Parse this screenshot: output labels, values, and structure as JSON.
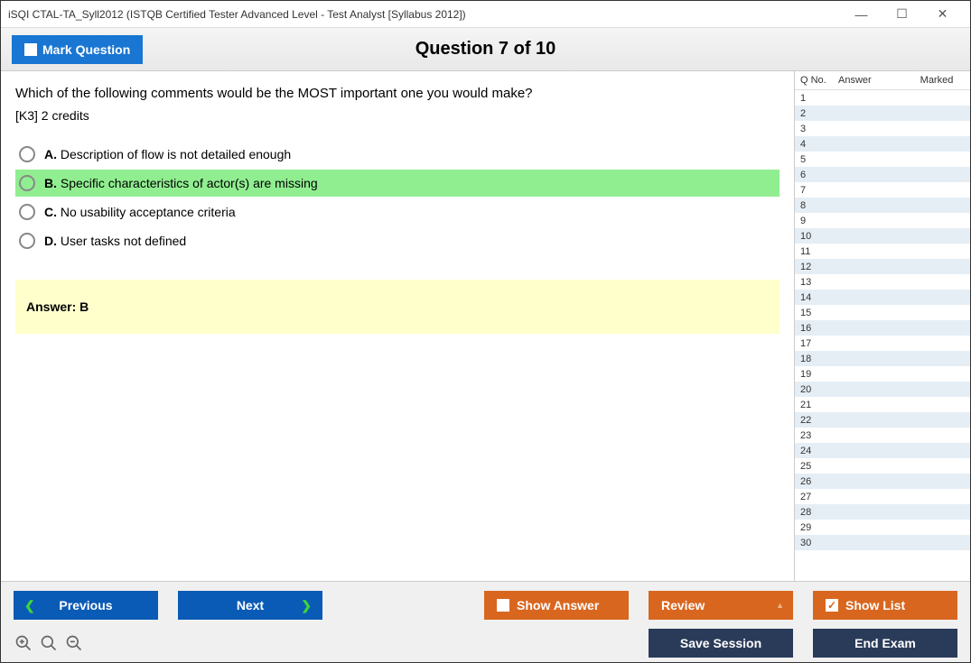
{
  "window": {
    "title": "iSQI CTAL-TA_Syll2012 (ISTQB Certified Tester Advanced Level - Test Analyst [Syllabus 2012])"
  },
  "header": {
    "mark_question_label": "Mark Question",
    "question_counter": "Question 7 of 10"
  },
  "question": {
    "text": "Which of the following comments would be the MOST important one you would make?",
    "credits": "[K3] 2 credits",
    "options": [
      {
        "letter": "A.",
        "text": "Description of flow is not detailed enough",
        "selected": false
      },
      {
        "letter": "B.",
        "text": "Specific characteristics of actor(s) are missing",
        "selected": true
      },
      {
        "letter": "C.",
        "text": "No usability acceptance criteria",
        "selected": false
      },
      {
        "letter": "D.",
        "text": "User tasks not defined",
        "selected": false
      }
    ],
    "answer_label": "Answer:",
    "answer_value": "B"
  },
  "sidebar": {
    "columns": {
      "qno": "Q No.",
      "answer": "Answer",
      "marked": "Marked"
    },
    "rows": [
      {
        "qno": "1",
        "answer": "",
        "marked": ""
      },
      {
        "qno": "2",
        "answer": "",
        "marked": ""
      },
      {
        "qno": "3",
        "answer": "",
        "marked": ""
      },
      {
        "qno": "4",
        "answer": "",
        "marked": ""
      },
      {
        "qno": "5",
        "answer": "",
        "marked": ""
      },
      {
        "qno": "6",
        "answer": "",
        "marked": ""
      },
      {
        "qno": "7",
        "answer": "",
        "marked": ""
      },
      {
        "qno": "8",
        "answer": "",
        "marked": ""
      },
      {
        "qno": "9",
        "answer": "",
        "marked": ""
      },
      {
        "qno": "10",
        "answer": "",
        "marked": ""
      },
      {
        "qno": "11",
        "answer": "",
        "marked": ""
      },
      {
        "qno": "12",
        "answer": "",
        "marked": ""
      },
      {
        "qno": "13",
        "answer": "",
        "marked": ""
      },
      {
        "qno": "14",
        "answer": "",
        "marked": ""
      },
      {
        "qno": "15",
        "answer": "",
        "marked": ""
      },
      {
        "qno": "16",
        "answer": "",
        "marked": ""
      },
      {
        "qno": "17",
        "answer": "",
        "marked": ""
      },
      {
        "qno": "18",
        "answer": "",
        "marked": ""
      },
      {
        "qno": "19",
        "answer": "",
        "marked": ""
      },
      {
        "qno": "20",
        "answer": "",
        "marked": ""
      },
      {
        "qno": "21",
        "answer": "",
        "marked": ""
      },
      {
        "qno": "22",
        "answer": "",
        "marked": ""
      },
      {
        "qno": "23",
        "answer": "",
        "marked": ""
      },
      {
        "qno": "24",
        "answer": "",
        "marked": ""
      },
      {
        "qno": "25",
        "answer": "",
        "marked": ""
      },
      {
        "qno": "26",
        "answer": "",
        "marked": ""
      },
      {
        "qno": "27",
        "answer": "",
        "marked": ""
      },
      {
        "qno": "28",
        "answer": "",
        "marked": ""
      },
      {
        "qno": "29",
        "answer": "",
        "marked": ""
      },
      {
        "qno": "30",
        "answer": "",
        "marked": ""
      }
    ]
  },
  "footer": {
    "previous_label": "Previous",
    "next_label": "Next",
    "show_answer_label": "Show Answer",
    "review_label": "Review",
    "show_list_label": "Show List",
    "save_session_label": "Save Session",
    "end_exam_label": "End Exam"
  }
}
